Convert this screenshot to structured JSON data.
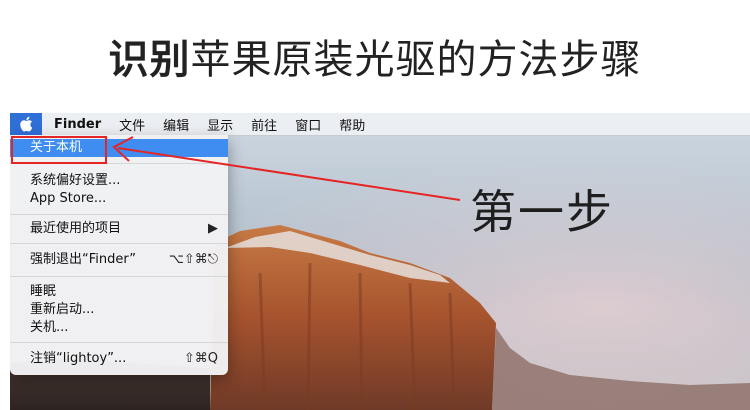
{
  "headline": {
    "bold": "识别",
    "rest": "苹果原装光驱的方法步骤"
  },
  "menubar": {
    "apple_icon": "apple-logo-icon",
    "items": [
      "Finder",
      "文件",
      "编辑",
      "显示",
      "前往",
      "窗口",
      "帮助"
    ]
  },
  "apple_menu": {
    "about": "关于本机",
    "system_prefs": "系统偏好设置...",
    "app_store": "App Store...",
    "recent_items": "最近使用的项目",
    "recent_arrow": "▶",
    "force_quit": "强制退出“Finder”",
    "force_quit_shortcut": "⌥⇧⌘⎋",
    "sleep": "睡眠",
    "restart": "重新启动...",
    "shutdown": "关机...",
    "logout": "注销“lightoy”...",
    "logout_shortcut": "⇧⌘Q"
  },
  "annotation": {
    "step_label": "第一步",
    "color": "#e52525"
  },
  "colors": {
    "highlight": "#3f8df0",
    "apple_box": "#2f6fd8"
  }
}
